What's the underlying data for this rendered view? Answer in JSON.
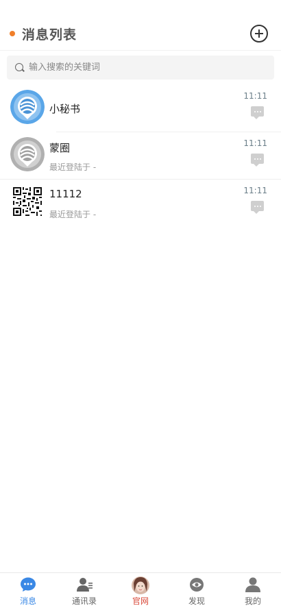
{
  "header": {
    "title": "消息列表"
  },
  "search": {
    "placeholder": "输入搜索的关键词"
  },
  "chats": [
    {
      "name": "小秘书",
      "subtitle": "",
      "time": "11:11",
      "avatar": "logo-blue"
    },
    {
      "name": "蒙圈",
      "subtitle": "最近登陆于 -",
      "time": "11:11",
      "avatar": "logo-gray"
    },
    {
      "name": "11112",
      "subtitle": "最近登陆于 -",
      "time": "11:11",
      "avatar": "qr-code"
    }
  ],
  "tabs": [
    {
      "label": "消息",
      "icon": "chat-bubble-icon",
      "active": true
    },
    {
      "label": "通讯录",
      "icon": "contacts-icon"
    },
    {
      "label": "官网",
      "icon": "official-avatar-icon"
    },
    {
      "label": "发现",
      "icon": "eye-icon"
    },
    {
      "label": "我的",
      "icon": "user-icon"
    }
  ],
  "colors": {
    "accent": "#3a88e5",
    "header_dot": "#f07f2a",
    "official": "#d94a3a"
  }
}
